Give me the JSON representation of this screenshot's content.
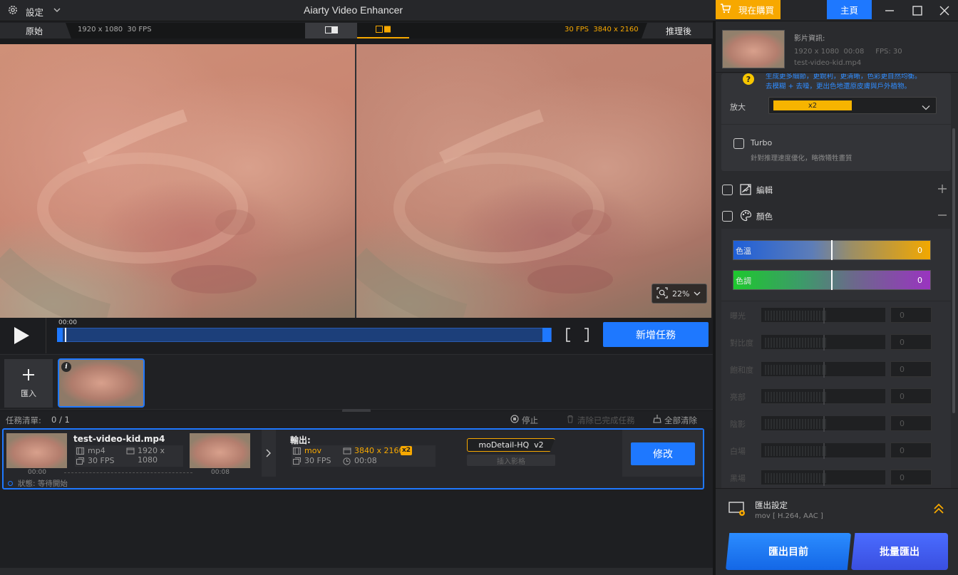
{
  "titlebar": {
    "settings_label": "設定",
    "app_title": "Aiarty Video Enhancer",
    "buy_label": "現在購買",
    "home_label": "主頁"
  },
  "viewer": {
    "original_tab": "原始",
    "original_info": "1920 x 1080  30 FPS",
    "enhanced_info": "30 FPS  3840 x 2160",
    "enhanced_tab": "推理後",
    "zoom": "22%"
  },
  "player": {
    "time": "00:00",
    "add_task_label": "新增任務"
  },
  "thumbs": {
    "import_label": "匯入"
  },
  "queue": {
    "task_list_label": "任務清單:",
    "task_count": "0 / 1",
    "stop_label": "停止",
    "clear_done_label": "清除已完成任務",
    "clear_all_label": "全部清除"
  },
  "task": {
    "filename": "test-video-kid.mp4",
    "in_format": "mp4",
    "in_res": "1920 x 1080",
    "in_fps": "30 FPS",
    "start_time": "00:00",
    "end_time": "00:08",
    "output_label": "輸出:",
    "out_format": "mov",
    "out_res": "3840 x 2160",
    "out_scale": "x2",
    "out_fps": "30 FPS",
    "out_duration": "00:08",
    "model": "moDetail-HQ  v2",
    "frame_interp": "插入影格",
    "modify_label": "修改",
    "status": "狀態: 等待開始"
  },
  "sidebar": {
    "video_info_label": "影片資訊:",
    "video_meta": "1920 x 1080  00:08     FPS: 30",
    "video_name": "test-video-kid.mp4",
    "desc_line1": "生成更多細節，更銳利，更清晰，色彩更自然均衡。",
    "desc_line2": "去模糊 + 去噪，更出色地還原皮膚與戶外植物。",
    "upscale_label": "放大",
    "upscale_value": "x2",
    "turbo_label": "Turbo",
    "turbo_desc": "針對推理速度優化，略微犧牲畫質",
    "edit_label": "編輯",
    "color_label": "顏色",
    "temp_label": "色溫",
    "temp_value": "0",
    "tint_label": "色調",
    "tint_value": "0",
    "adjustments": [
      {
        "label": "曝光",
        "value": "0"
      },
      {
        "label": "對比度",
        "value": "0"
      },
      {
        "label": "飽和度",
        "value": "0"
      },
      {
        "label": "亮部",
        "value": "0"
      },
      {
        "label": "陰影",
        "value": "0"
      },
      {
        "label": "白場",
        "value": "0"
      },
      {
        "label": "黑場",
        "value": "0"
      }
    ],
    "export_settings_label": "匯出設定",
    "export_format": "mov [ H.264, AAC ]",
    "export_current_label": "匯出目前",
    "batch_export_label": "批量匯出"
  },
  "colors": {
    "accent": "#1e78ff",
    "orange": "#f7a800",
    "purple": "#3a5ef0"
  }
}
